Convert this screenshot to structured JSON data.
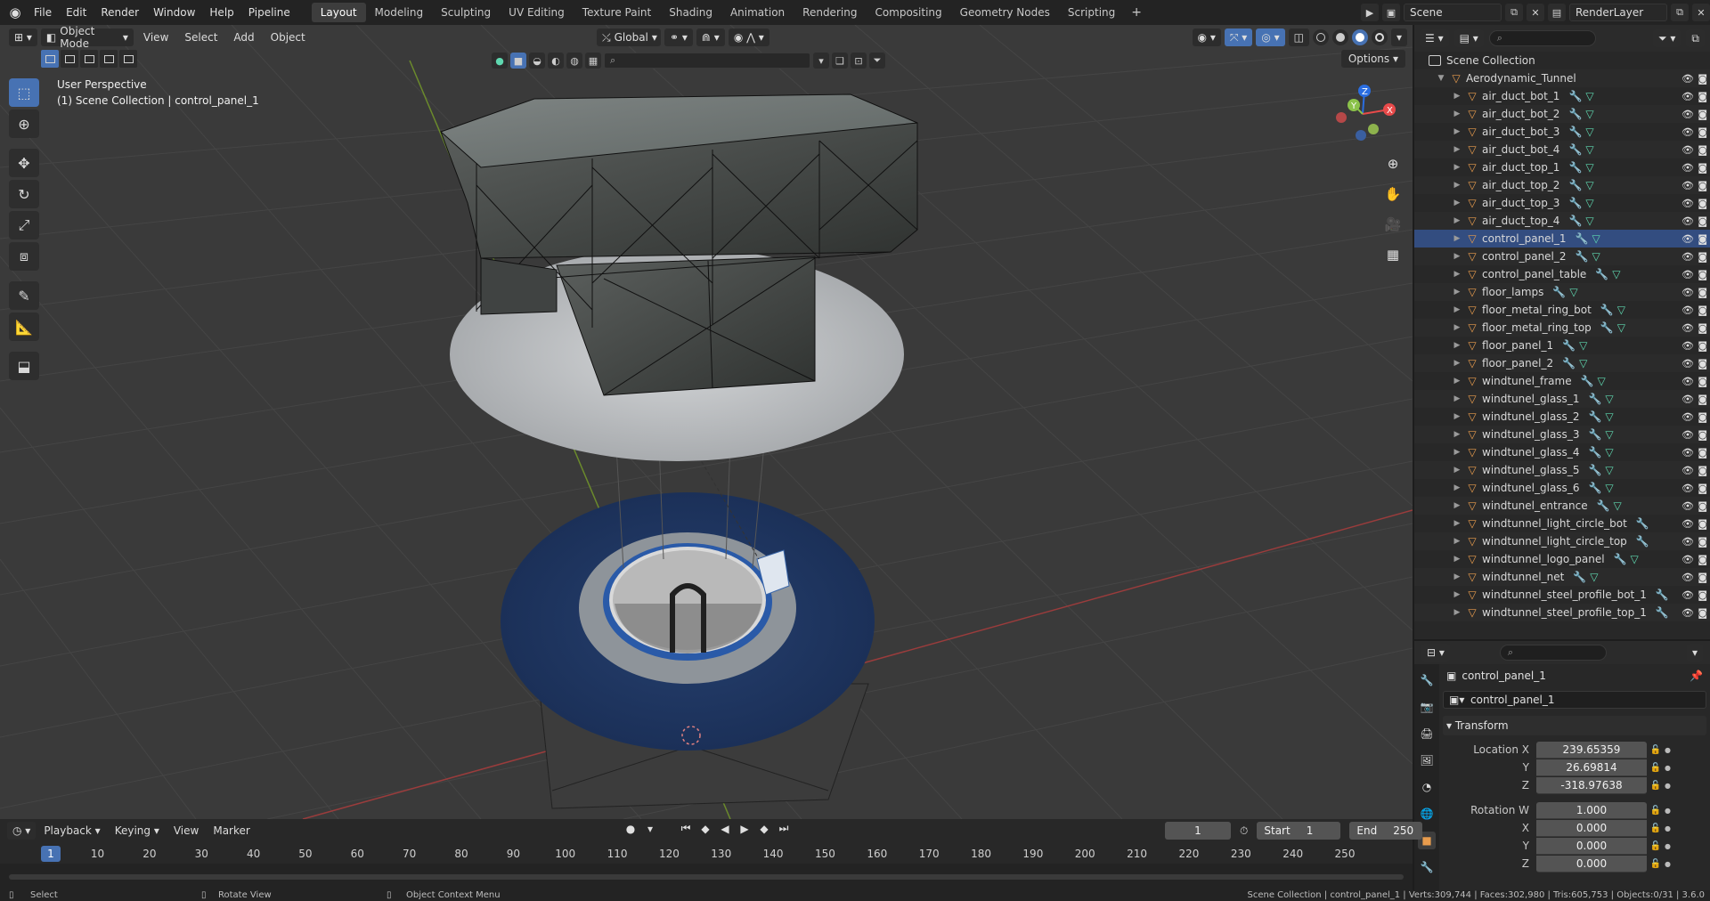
{
  "menu": [
    "File",
    "Edit",
    "Render",
    "Window",
    "Help",
    "Pipeline"
  ],
  "workspaces": [
    {
      "label": "Layout",
      "active": true
    },
    {
      "label": "Modeling"
    },
    {
      "label": "Sculpting"
    },
    {
      "label": "UV Editing"
    },
    {
      "label": "Texture Paint"
    },
    {
      "label": "Shading"
    },
    {
      "label": "Animation"
    },
    {
      "label": "Rendering"
    },
    {
      "label": "Compositing"
    },
    {
      "label": "Geometry Nodes"
    },
    {
      "label": "Scripting"
    }
  ],
  "workspace_add": "+",
  "scene_name": "Scene",
  "render_layer": "RenderLayer",
  "viewport": {
    "mode": "Object Mode",
    "menus": [
      "View",
      "Select",
      "Add",
      "Object"
    ],
    "orientation": "Global",
    "options": "Options",
    "info_line1": "User Perspective",
    "info_line2": "(1) Scene Collection | control_panel_1",
    "gizmo": {
      "x": "X",
      "y": "Y",
      "z": "Z"
    }
  },
  "outliner": {
    "root": "Scene Collection",
    "collection": "Aerodynamic_Tunnel",
    "selected": "control_panel_1",
    "items": [
      "air_duct_bot_1",
      "air_duct_bot_2",
      "air_duct_bot_3",
      "air_duct_bot_4",
      "air_duct_top_1",
      "air_duct_top_2",
      "air_duct_top_3",
      "air_duct_top_4",
      "control_panel_1",
      "control_panel_2",
      "control_panel_table",
      "floor_lamps",
      "floor_metal_ring_bot",
      "floor_metal_ring_top",
      "floor_panel_1",
      "floor_panel_2",
      "windtunel_frame",
      "windtunel_glass_1",
      "windtunel_glass_2",
      "windtunel_glass_3",
      "windtunel_glass_4",
      "windtunel_glass_5",
      "windtunel_glass_6",
      "windtunel_entrance",
      "windtunnel_light_circle_bot",
      "windtunnel_light_circle_top",
      "windtunnel_logo_panel",
      "windtunnel_net",
      "windtunnel_steel_profile_bot_1",
      "windtunnel_steel_profile_top_1"
    ]
  },
  "properties": {
    "object_title": "control_panel_1",
    "object_name": "control_panel_1",
    "section": "Transform",
    "location": {
      "label_x": "Location X",
      "label_y": "Y",
      "label_z": "Z",
      "x": "239.65359",
      "y": "26.69814",
      "z": "-318.97638"
    },
    "rotation": {
      "label_w": "Rotation W",
      "label_x": "X",
      "label_y": "Y",
      "label_z": "Z",
      "w": "1.000",
      "x": "0.000",
      "y": "0.000",
      "z": "0.000"
    }
  },
  "timeline": {
    "menus": [
      "Playback",
      "Keying",
      "View",
      "Marker"
    ],
    "current_frame": "1",
    "start_label": "Start",
    "start": "1",
    "end_label": "End",
    "end": "250",
    "ruler": [
      "1",
      "10",
      "20",
      "30",
      "40",
      "50",
      "60",
      "70",
      "80",
      "90",
      "100",
      "110",
      "120",
      "130",
      "140",
      "150",
      "160",
      "170",
      "180",
      "190",
      "200",
      "210",
      "220",
      "230",
      "240",
      "250"
    ]
  },
  "status": {
    "select": "Select",
    "rotate": "Rotate View",
    "context": "Object Context Menu",
    "stats": "Scene Collection | control_panel_1 | Verts:309,744 | Faces:302,980 | Tris:605,753 | Objects:0/31 | 3.6.0"
  },
  "colors": {
    "accent": "#4772b3",
    "object_icon": "#e89c4d",
    "mesh_icon": "#5fd8b0",
    "modifier_icon": "#7fa9e8"
  }
}
